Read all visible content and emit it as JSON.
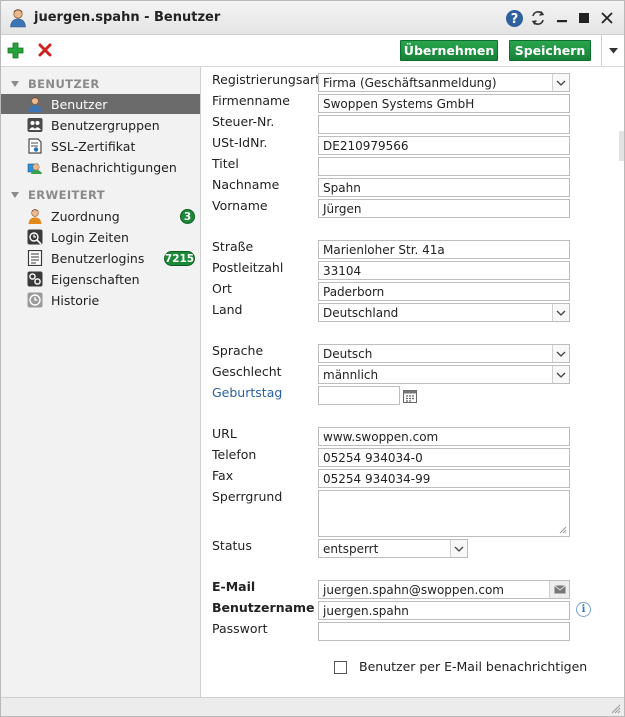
{
  "window": {
    "title": "juergen.spahn - Benutzer"
  },
  "toolbar": {
    "apply_label": "Übernehmen",
    "save_label": "Speichern"
  },
  "sidebar": {
    "section_user": "BENUTZER",
    "section_extended": "ERWEITERT",
    "items_user": [
      {
        "label": "Benutzer",
        "icon": "user-icon"
      },
      {
        "label": "Benutzergruppen",
        "icon": "group-icon"
      },
      {
        "label": "SSL-Zertifikat",
        "icon": "certificate-icon"
      },
      {
        "label": "Benachrichtigungen",
        "icon": "notification-icon"
      }
    ],
    "items_extended": [
      {
        "label": "Zuordnung",
        "icon": "user-assign-icon",
        "badge": "3"
      },
      {
        "label": "Login Zeiten",
        "icon": "clock-icon"
      },
      {
        "label": "Benutzerlogins",
        "icon": "list-icon",
        "badge": "7215"
      },
      {
        "label": "Eigenschaften",
        "icon": "properties-icon"
      },
      {
        "label": "Historie",
        "icon": "history-icon"
      }
    ]
  },
  "form": {
    "registration_type": {
      "label": "Registrierungsart",
      "value": "Firma (Geschäftsanmeldung)"
    },
    "company": {
      "label": "Firmenname",
      "value": "Swoppen Systems GmbH"
    },
    "tax_no": {
      "label": "Steuer-Nr.",
      "value": ""
    },
    "vat_id": {
      "label": "USt-IdNr.",
      "value": "DE210979566"
    },
    "title": {
      "label": "Titel",
      "value": ""
    },
    "last_name": {
      "label": "Nachname",
      "value": "Spahn"
    },
    "first_name": {
      "label": "Vorname",
      "value": "Jürgen"
    },
    "street": {
      "label": "Straße",
      "value": "Marienloher Str. 41a"
    },
    "zip": {
      "label": "Postleitzahl",
      "value": "33104"
    },
    "city": {
      "label": "Ort",
      "value": "Paderborn"
    },
    "country": {
      "label": "Land",
      "value": "Deutschland"
    },
    "language": {
      "label": "Sprache",
      "value": "Deutsch"
    },
    "gender": {
      "label": "Geschlecht",
      "value": "männlich"
    },
    "birthday": {
      "label": "Geburtstag",
      "value": ""
    },
    "url": {
      "label": "URL",
      "value": "www.swoppen.com"
    },
    "phone": {
      "label": "Telefon",
      "value": "05254 934034-0"
    },
    "fax": {
      "label": "Fax",
      "value": "05254 934034-99"
    },
    "block_reason": {
      "label": "Sperrgrund",
      "value": ""
    },
    "status": {
      "label": "Status",
      "value": "entsperrt"
    },
    "email": {
      "label": "E-Mail",
      "value": "juergen.spahn@swoppen.com"
    },
    "username": {
      "label": "Benutzername",
      "value": "juergen.spahn"
    },
    "password": {
      "label": "Passwort",
      "value": ""
    },
    "notify_label": "Benutzer per E-Mail benachrichtigen"
  },
  "colors": {
    "accent_green": "#1d8a3a",
    "link_blue": "#2b5fa1",
    "active_nav": "#6b6b6b"
  }
}
